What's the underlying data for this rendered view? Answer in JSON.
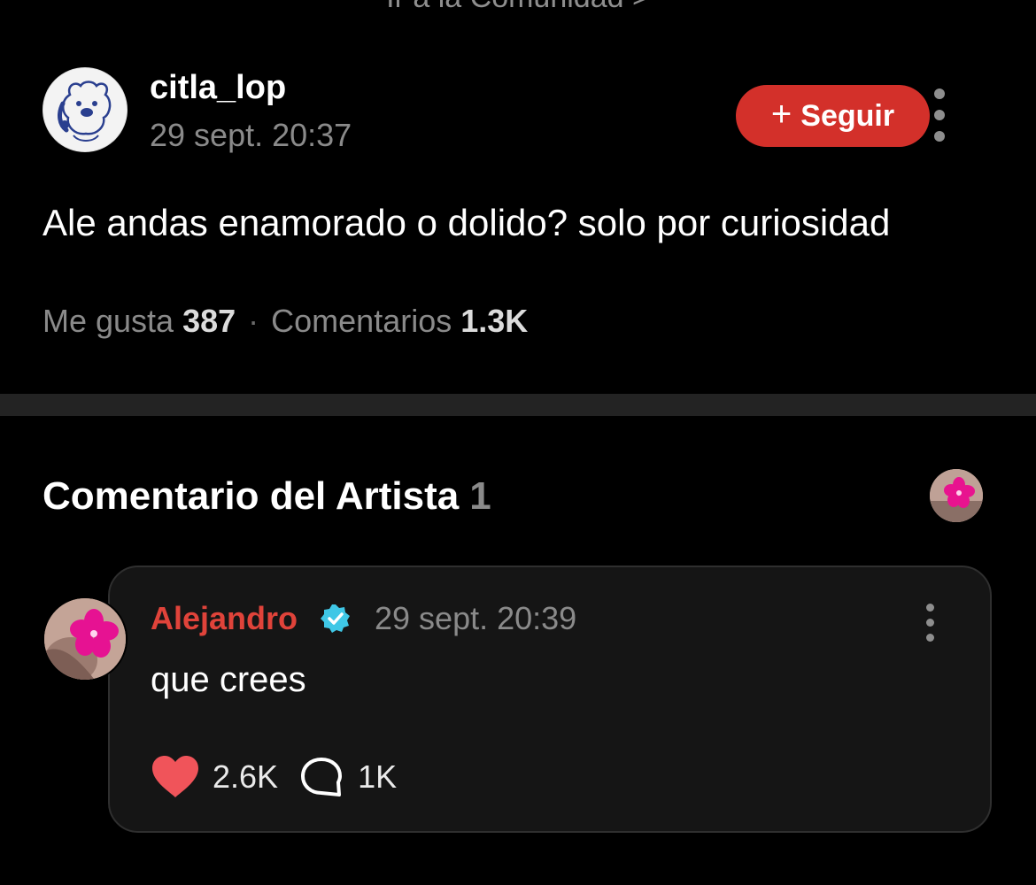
{
  "header": {
    "community_link": "Ir a la Comunidad >"
  },
  "post": {
    "username": "citla_lop",
    "timestamp": "29 sept. 20:37",
    "follow_label": "Seguir",
    "text": "Ale andas enamorado o dolido? solo por curiosidad",
    "likes_label": "Me gusta",
    "likes_count": "387",
    "separator": "·",
    "comments_label": "Comentarios",
    "comments_count": "1.3K"
  },
  "artist_section": {
    "title": "Comentario del Artista",
    "count": "1"
  },
  "artist_comment": {
    "author": "Alejandro",
    "verified": true,
    "timestamp": "29 sept. 20:39",
    "text": "que crees",
    "likes": "2.6K",
    "replies": "1K"
  },
  "icons": {
    "follow": "plus-icon",
    "more": "more-vertical-icon",
    "verified": "verified-badge-icon",
    "like": "heart-icon",
    "reply": "speech-bubble-icon"
  },
  "colors": {
    "background": "#000000",
    "accent_red": "#d3302a",
    "author_red": "#e0433a",
    "verified_cyan": "#3fc7e6",
    "heart": "#f0545a",
    "muted_text": "#8a8a8a",
    "card_bg": "#151515"
  }
}
